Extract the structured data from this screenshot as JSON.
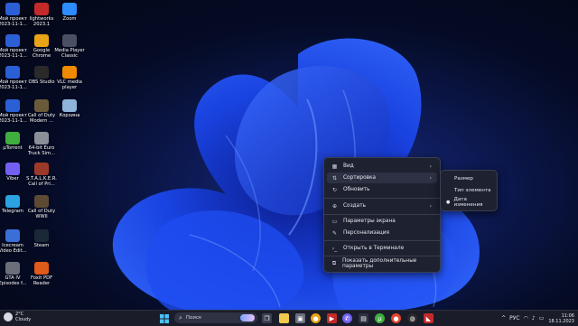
{
  "desktop": {
    "icons": [
      {
        "label": "Мой проект\n2023-11-1...",
        "icon": "video-project-icon",
        "color": "#2b5fd6"
      },
      {
        "label": "lightworks\n2023.1",
        "icon": "lightworks-icon",
        "color": "#c42a2a"
      },
      {
        "label": "Zoom",
        "icon": "zoom-icon",
        "color": "#2d8cff"
      },
      {
        "label": "Мой проект\n2023-11-1...",
        "icon": "video-project-icon",
        "color": "#2b5fd6"
      },
      {
        "label": "Google\nChrome",
        "icon": "chrome-icon",
        "color": "#e8a317"
      },
      {
        "label": "Media Player\nClassic",
        "icon": "mpc-icon",
        "color": "#4a4f63"
      },
      {
        "label": "Мой проект\n2023-11-1...",
        "icon": "video-project-icon",
        "color": "#2b5fd6"
      },
      {
        "label": "OBS Studio",
        "icon": "obs-icon",
        "color": "#2a2a2a"
      },
      {
        "label": "VLC media\nplayer",
        "icon": "vlc-icon",
        "color": "#f08a00"
      },
      {
        "label": "Мой проект\n2023-11-1...",
        "icon": "video-project-icon",
        "color": "#2b5fd6"
      },
      {
        "label": "Call of Duty\nModern ...",
        "icon": "cod-icon",
        "color": "#6b5a3a"
      },
      {
        "label": "Корзина",
        "icon": "recycle-bin-icon",
        "color": "#8fb4d9"
      },
      {
        "label": "µTorrent",
        "icon": "utorrent-icon",
        "color": "#3fae3f"
      },
      {
        "label": "64-bit Euro\nTruck Sim...",
        "icon": "ets-icon",
        "color": "#8a8f99"
      },
      {
        "label": "Viber",
        "icon": "viber-icon",
        "color": "#7360f2"
      },
      {
        "label": "S.T.A.L.K.E.R.\nCall of Pri...",
        "icon": "stalker-icon",
        "color": "#9c3a2a"
      },
      {
        "label": "Telegram",
        "icon": "telegram-icon",
        "color": "#2aa3e0"
      },
      {
        "label": "Call of Duty\nWWII",
        "icon": "cod-ww2-icon",
        "color": "#5c4a34"
      },
      {
        "label": "Icecream\nVideo Edit...",
        "icon": "icecream-icon",
        "color": "#3a6fd8"
      },
      {
        "label": "Steam",
        "icon": "steam-icon",
        "color": "#1b2838"
      },
      {
        "label": "GTA IV\nEpisodes f...",
        "icon": "gta-icon",
        "color": "#6a6f7a"
      },
      {
        "label": "Foxit PDF\nReader",
        "icon": "foxit-icon",
        "color": "#e05a1a"
      }
    ]
  },
  "context_menu": {
    "items": [
      {
        "label": "Вид",
        "icon": "grid-icon",
        "arrow": "›"
      },
      {
        "label": "Сортировка",
        "icon": "sort-icon",
        "arrow": "›"
      },
      {
        "label": "Обновить",
        "icon": "refresh-icon"
      },
      {
        "label": "Создать",
        "icon": "add-icon",
        "arrow": "›"
      },
      {
        "label": "Параметры экрана",
        "icon": "display-icon"
      },
      {
        "label": "Персонализация",
        "icon": "brush-icon"
      },
      {
        "label": "Открыть в Терминале",
        "icon": "terminal-icon"
      },
      {
        "label": "Показать дополнительные параметры",
        "icon": "more-options-icon"
      }
    ],
    "submenu": [
      {
        "label": "Размер"
      },
      {
        "label": "Тип элемента"
      },
      {
        "label": "Дата изменения",
        "selected": true
      }
    ]
  },
  "taskbar": {
    "weather": {
      "temp": "2°C",
      "condition": "Cloudy"
    },
    "search_placeholder": "Поиск",
    "apps": [
      "start-icon",
      "task-view-icon",
      "explorer-icon",
      "chrome-icon",
      "viber-icon",
      "media-icon",
      "store-icon",
      "utorrent-icon",
      "vlc-icon",
      "video-icon",
      "obs-icon",
      "lightworks-icon"
    ],
    "tray": {
      "chevron": "^",
      "lang": "РУС",
      "wifi": "wifi-icon",
      "volume": "volume-icon",
      "battery": "battery-icon"
    },
    "clock": {
      "time": "11:06",
      "date": "18.11.2023"
    }
  }
}
